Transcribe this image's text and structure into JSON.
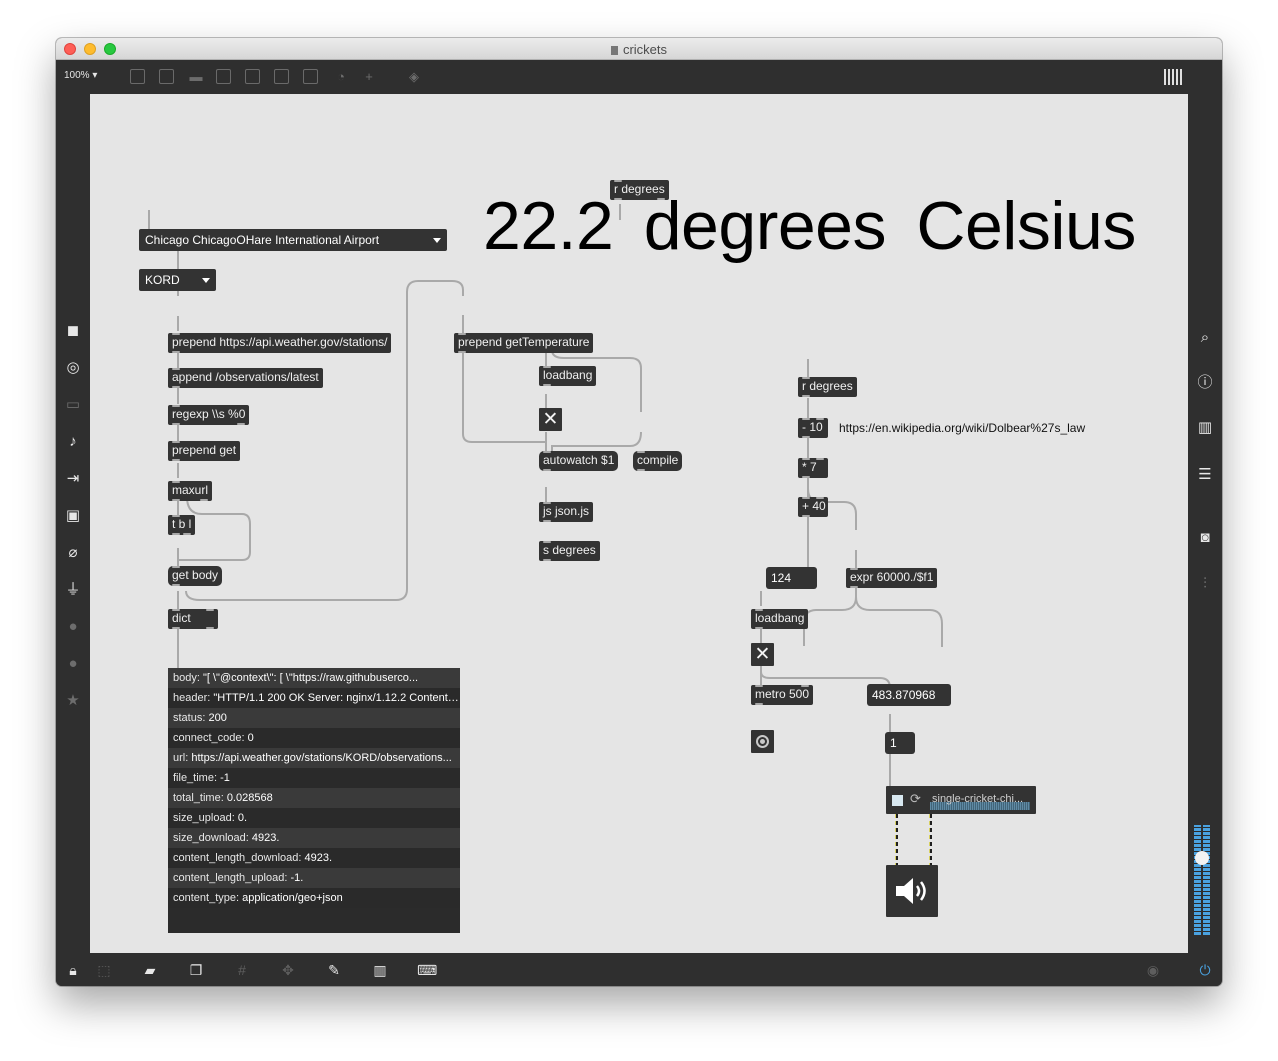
{
  "window": {
    "title": "crickets"
  },
  "toolbar": {
    "zoom": "100%"
  },
  "canvas": {
    "temperature_display": "22.2  degrees Celsius",
    "station_name_menu": "Chicago ChicagoOHare International Airport",
    "station_id_menu": "KORD",
    "objects": {
      "r_degrees_top": "r degrees",
      "prepend_url": "prepend https://api.weather.gov/stations/",
      "append_obs": "append /observations/latest",
      "regexp": "regexp \\\\s %0",
      "prepend_get": "prepend get",
      "maxurl": "maxurl",
      "tbl": "t b l",
      "get_body": "get body",
      "dict": "dict",
      "prepend_gettemp": "prepend getTemperature",
      "loadbang_js": "loadbang",
      "autowatch": "autowatch $1",
      "compile": "compile",
      "js_json": "js json.js",
      "s_degrees": "s degrees",
      "r_degrees_right": "r degrees",
      "minus10": "- 10",
      "times7": "* 7",
      "plus40": "+ 40",
      "expr": "expr 60000./$f1",
      "loadbang_metro": "loadbang",
      "metro": "metro 500"
    },
    "numbers": {
      "chirps": "124",
      "interval": "483.870968",
      "counter": "1"
    },
    "comment_link": "https://en.wikipedia.org/wiki/Dolbear%27s_law",
    "sfplay_file": "single-cricket-chi...",
    "dict_rows": [
      {
        "key": "body:",
        "value": "\"[     \\\"@context\\\": [        \\\"https://raw.githubuserco..."
      },
      {
        "key": "header:",
        "value": "\"HTTP/1.1 200 OK Server: nginx/1.12.2 Content-..."
      },
      {
        "key": "status:",
        "value": "200"
      },
      {
        "key": "connect_code:",
        "value": "0"
      },
      {
        "key": "url:",
        "value": "https://api.weather.gov/stations/KORD/observations..."
      },
      {
        "key": "file_time:",
        "value": "-1"
      },
      {
        "key": "total_time:",
        "value": "0.028568"
      },
      {
        "key": "size_upload:",
        "value": "0."
      },
      {
        "key": "size_download:",
        "value": "4923."
      },
      {
        "key": "content_length_download:",
        "value": "4923."
      },
      {
        "key": "content_length_upload:",
        "value": "-1."
      },
      {
        "key": "content_type:",
        "value": "application/geo+json"
      }
    ]
  },
  "colors": {
    "canvas_bg": "#e5e5e5",
    "object_bg": "#333333",
    "accent_blue": "#4aa2e0"
  }
}
